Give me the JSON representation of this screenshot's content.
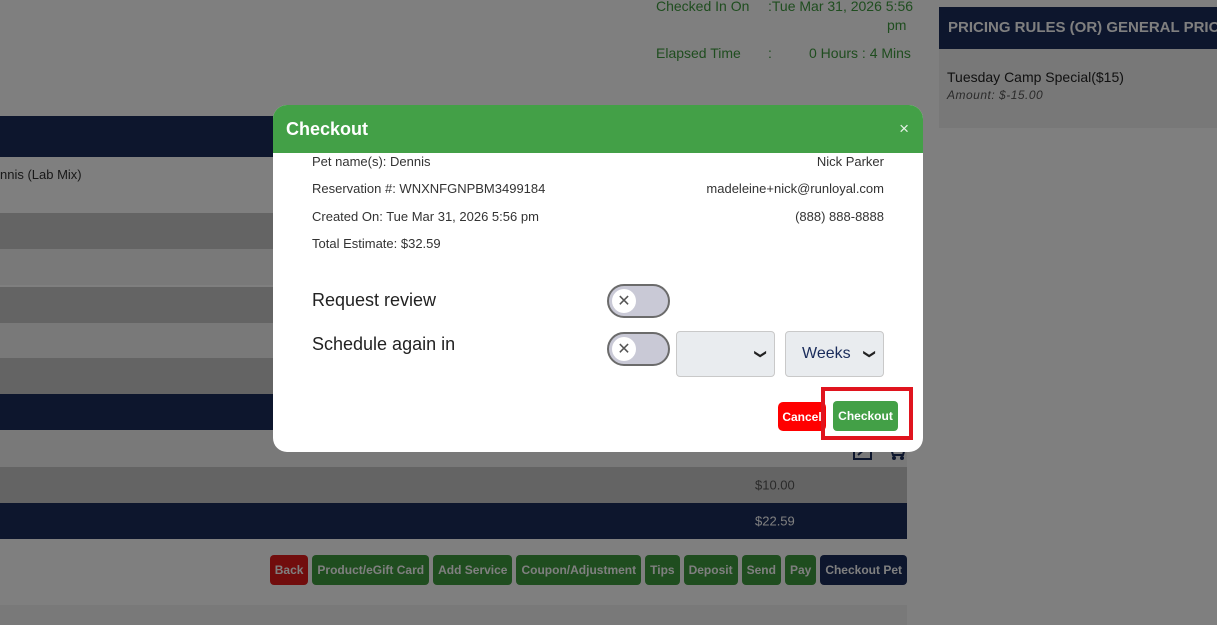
{
  "background": {
    "checked_in_label": "Checked In On",
    "checked_in_value": ":Tue Mar 31, 2026 5:56",
    "checked_in_value_cont": "pm",
    "elapsed_label": "Elapsed Time",
    "elapsed_sep": ":",
    "elapsed_value": "0 Hours : 4 Mins",
    "pet_text": "nnis (Lab Mix)",
    "row_amount_1": "$10.00",
    "row_amount_2": "$22.59",
    "partial_amount": "$10.00"
  },
  "pricing_panel": {
    "title": "PRICING RULES (OR) GENERAL PRICING",
    "item_name": "Tuesday Camp Special($15)",
    "item_amount": "Amount: $-15.00"
  },
  "actions": [
    {
      "label": "Back",
      "color": "#e21b1b"
    },
    {
      "label": "Product/eGift Card",
      "color": "#3e9a3e"
    },
    {
      "label": "Add Service",
      "color": "#3e9a3e"
    },
    {
      "label": "Coupon/Adjustment",
      "color": "#3e9a3e"
    },
    {
      "label": "Tips",
      "color": "#3e9a3e"
    },
    {
      "label": "Deposit",
      "color": "#3e9a3e"
    },
    {
      "label": "Send",
      "color": "#3e9a3e"
    },
    {
      "label": "Pay",
      "color": "#3e9a3e"
    },
    {
      "label": "Checkout Pet",
      "color": "#1a2c5b"
    }
  ],
  "modal": {
    "title": "Checkout",
    "close": "×",
    "pet_names": "Pet name(s): Dennis",
    "reservation": "Reservation #: WNXNFGNPBM3499184",
    "created_on": "Created On: Tue Mar 31, 2026 5:56 pm",
    "total_estimate": "Total Estimate: $32.59",
    "owner_name": "Nick Parker",
    "owner_email": "madeleine+nick@runloyal.com",
    "owner_phone": "(888) 888-8888",
    "request_review_label": "Request review",
    "request_review_on": false,
    "schedule_again_label": "Schedule again in",
    "schedule_again_on": false,
    "schedule_count_value": "",
    "schedule_unit_value": "Weeks",
    "cancel_label": "Cancel",
    "checkout_label": "Checkout"
  },
  "colors": {
    "header_green": "#43a047",
    "navy": "#1a2c5b",
    "cancel_red": "#ff0000",
    "highlight_red": "#e0141e"
  }
}
